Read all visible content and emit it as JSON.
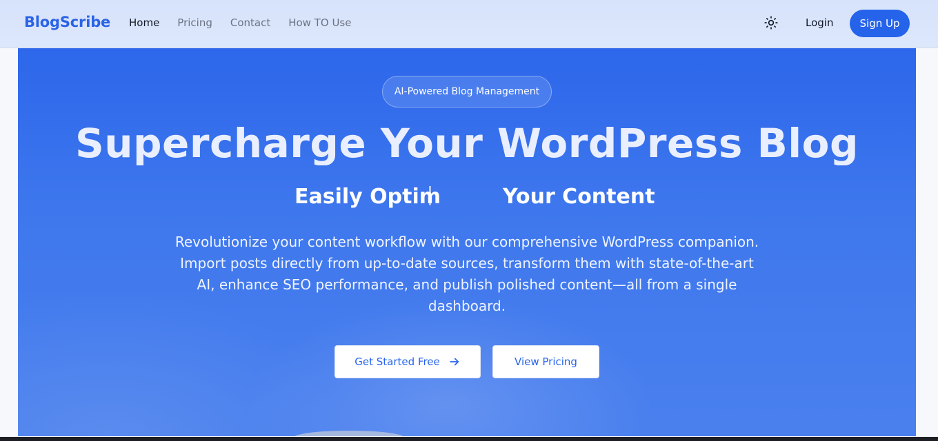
{
  "navbar": {
    "logo": "BlogScribe",
    "links": [
      "Home",
      "Pricing",
      "Contact",
      "How TO Use"
    ],
    "active_link": "Home",
    "theme_icon": "sun-icon",
    "login_label": "Login",
    "signup_label": "Sign Up"
  },
  "hero": {
    "badge": "AI-Powered Blog Management",
    "headline": "Supercharge Your WordPress Blog",
    "subheadline_part1": "Easily Optim",
    "subheadline_part2": "Your Content",
    "description": "Revolutionize your content workflow with our comprehensive WordPress companion. Import posts directly from up-to-date sources, transform them with state-of-the-art AI, enhance SEO performance, and publish polished content—all from a single dashboard.",
    "primary_cta": "Get Started Free",
    "primary_cta_icon": "arrow-right-icon",
    "secondary_cta": "View Pricing"
  },
  "colors": {
    "brand": "#2563eb",
    "hero_bg": "#3b74ec",
    "navbar_bg": "#dbe5fc"
  }
}
